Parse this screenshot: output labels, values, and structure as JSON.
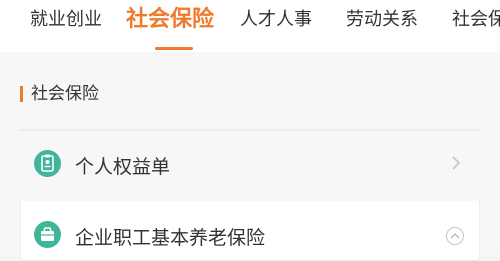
{
  "tabs": [
    {
      "label": "就业创业",
      "active": false
    },
    {
      "label": "社会保险",
      "active": true
    },
    {
      "label": "人才人事",
      "active": false
    },
    {
      "label": "劳动关系",
      "active": false
    },
    {
      "label": "社会保",
      "active": false
    }
  ],
  "section": {
    "title": "社会保险"
  },
  "items": [
    {
      "label": "个人权益单",
      "icon": "id-badge-icon",
      "action": "chevron-right-icon"
    },
    {
      "label": "企业职工基本养老保险",
      "icon": "briefcase-icon",
      "action": "chevron-up-icon"
    }
  ],
  "colors": {
    "accent": "#f07a2c",
    "icon_bg": "#3fb59a"
  }
}
